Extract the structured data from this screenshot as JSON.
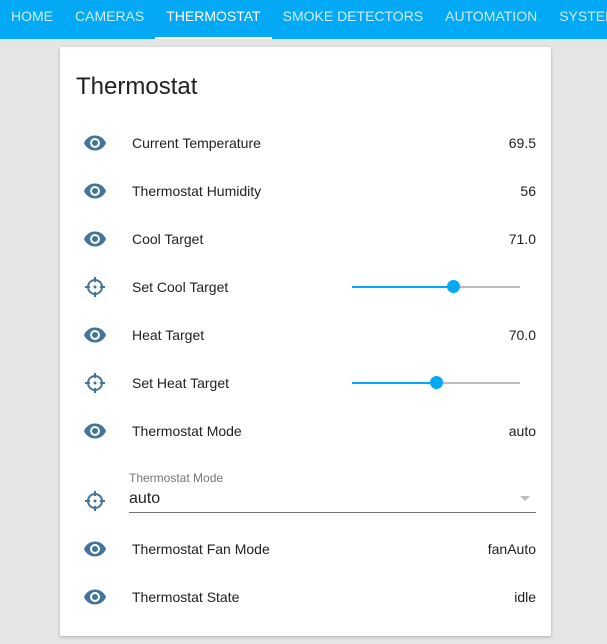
{
  "tabs": [
    "HOME",
    "CAMERAS",
    "THERMOSTAT",
    "SMOKE DETECTORS",
    "AUTOMATION",
    "SYSTEM"
  ],
  "active_tab": "THERMOSTAT",
  "card": {
    "title": "Thermostat"
  },
  "rows": [
    {
      "icon": "eye-icon",
      "label": "Current Temperature",
      "value": "69.5"
    },
    {
      "icon": "eye-icon",
      "label": "Thermostat Humidity",
      "value": "56"
    },
    {
      "icon": "eye-icon",
      "label": "Cool Target",
      "value": "71.0"
    },
    {
      "icon": "crosshair-icon",
      "label": "Set Cool Target",
      "slider": 0.6
    },
    {
      "icon": "eye-icon",
      "label": "Heat Target",
      "value": "70.0"
    },
    {
      "icon": "crosshair-icon",
      "label": "Set Heat Target",
      "slider": 0.5
    },
    {
      "icon": "eye-icon",
      "label": "Thermostat Mode",
      "value": "auto"
    },
    {
      "icon": "eye-icon",
      "label": "Thermostat Fan Mode",
      "value": "fanAuto"
    },
    {
      "icon": "eye-icon",
      "label": "Thermostat State",
      "value": "idle"
    }
  ],
  "dropdown": {
    "label": "Thermostat Mode",
    "value": "auto"
  },
  "colors": {
    "accent": "#03a9f4",
    "icon": "#44739e"
  }
}
